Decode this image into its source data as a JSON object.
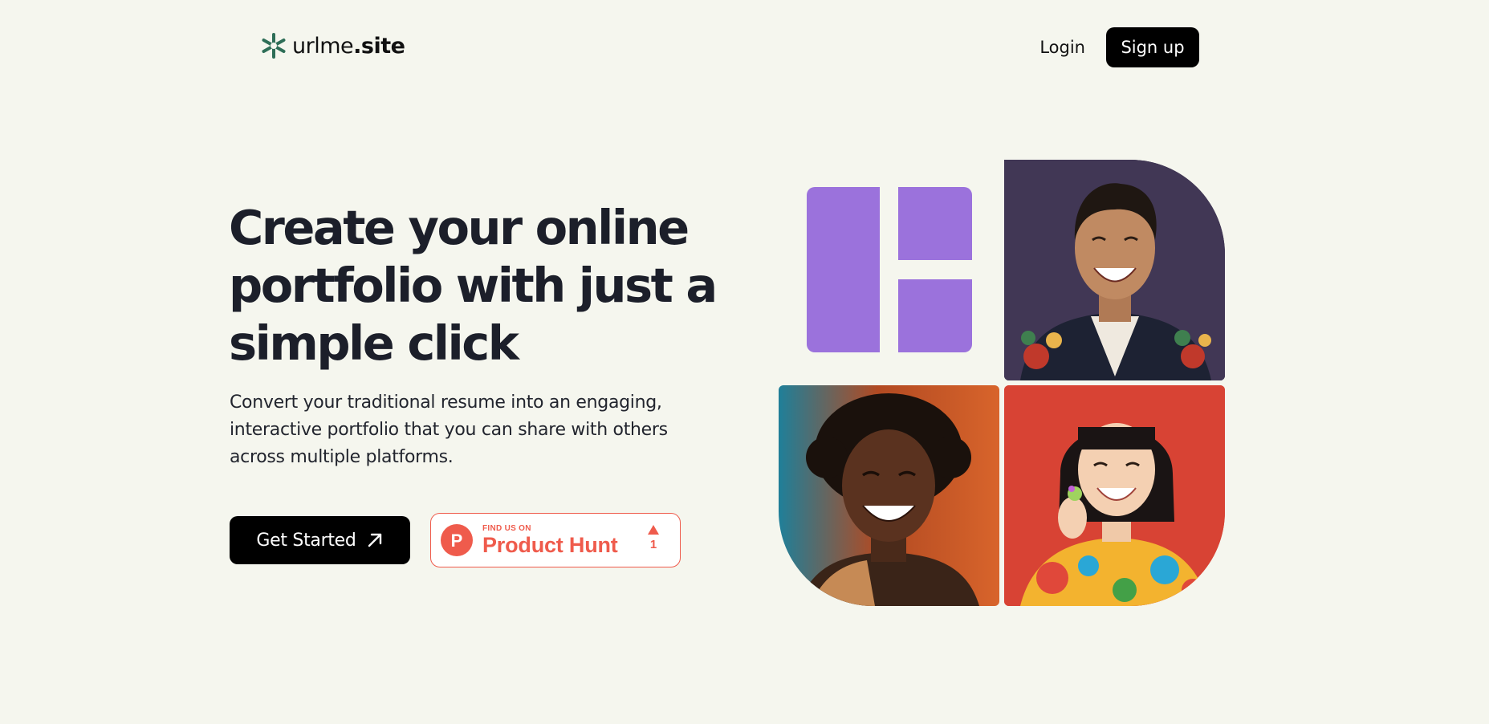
{
  "header": {
    "logo": {
      "icon": "asterisk-logo-icon",
      "name_regular": "urlme",
      "name_bold": ".site"
    },
    "nav": {
      "login_label": "Login",
      "signup_label": "Sign up"
    }
  },
  "hero": {
    "title": "Create your online portfolio with just a simple click",
    "description": "Convert your traditional resume into an engaging, interactive portfolio that you can share with others across multiple platforms.",
    "cta": {
      "label": "Get Started",
      "icon": "arrow-up-right-icon"
    },
    "product_hunt": {
      "small_label": "FIND US ON",
      "big_label": "Product Hunt",
      "logo_letter": "P",
      "upvote_count": "1",
      "color": "#ef5b4c"
    }
  },
  "collage": {
    "accent_color": "#9b72dc",
    "images": [
      {
        "name": "smiling-man-floral-jacket",
        "background": "#3d3450"
      },
      {
        "name": "smiling-man-curly-hair",
        "background": "#1f7f99"
      },
      {
        "name": "smiling-woman-colorful-shirt",
        "background": "#d84334"
      }
    ]
  },
  "colors": {
    "page_background": "#f5f6ee",
    "text_dark": "#1c1f2a",
    "button_black": "#000000",
    "logo_green": "#2e6e57"
  }
}
